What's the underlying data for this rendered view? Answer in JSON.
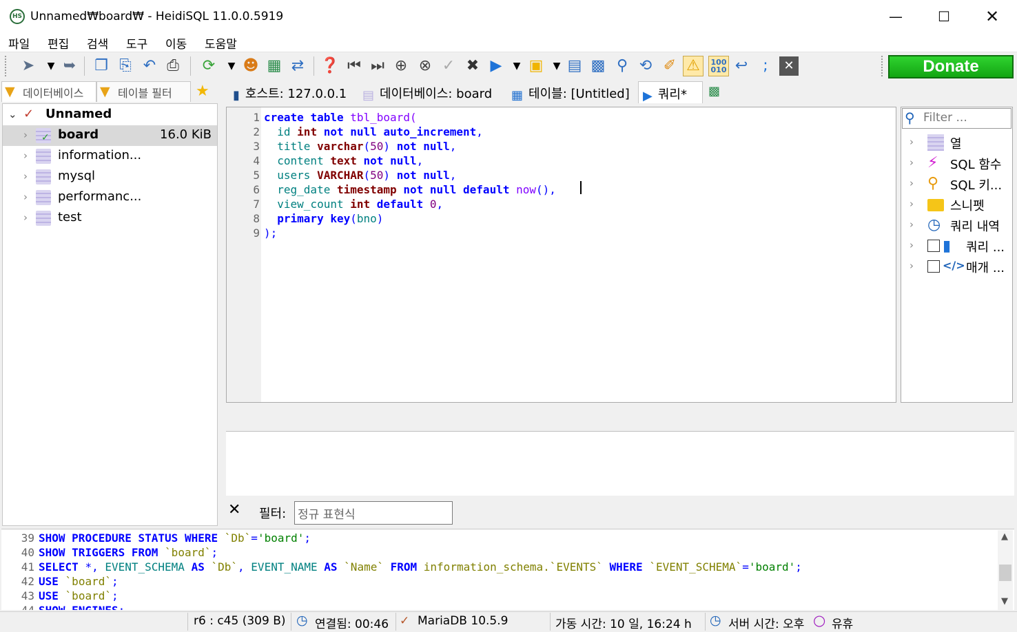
{
  "window": {
    "title": "Unnamed₩board₩ - HeidiSQL 11.0.0.5919",
    "icon_text": "HS",
    "controls": [
      "minimize-icon",
      "maximize-icon",
      "close-icon"
    ]
  },
  "menu": [
    "파일",
    "편집",
    "검색",
    "도구",
    "이동",
    "도움말"
  ],
  "toolbar": {
    "donate_label": "Donate",
    "buttons": [
      "connect-icon",
      "dropdown-arrow-icon",
      "disconnect-icon",
      "copy-icon",
      "paste-icon",
      "undo-icon",
      "print-icon",
      "refresh-icon",
      "user-manager-icon",
      "export-icon",
      "sync-icon",
      "help-icon",
      "first-icon",
      "last-icon",
      "add-icon",
      "cancel-icon",
      "apply-icon",
      "delete-icon",
      "run-icon",
      "open-folder-icon",
      "save-icon",
      "explain-icon",
      "find-icon",
      "replace-icon",
      "clean-icon",
      "warning-icon",
      "binary-icon",
      "wrap-icon",
      "semicolon-icon",
      "close-tab-icon"
    ]
  },
  "left_panel": {
    "tabs": [
      "데이터베이스",
      "테이블 필터"
    ],
    "tree": {
      "root": "Unnamed",
      "items": [
        {
          "label": "board",
          "size": "16.0 KiB",
          "selected": true
        },
        {
          "label": "information...",
          "size": ""
        },
        {
          "label": "mysql",
          "size": ""
        },
        {
          "label": "performanc...",
          "size": ""
        },
        {
          "label": "test",
          "size": ""
        }
      ]
    }
  },
  "main_tabs": [
    {
      "label": "호스트: 127.0.0.1",
      "icon": "server-icon"
    },
    {
      "label": "데이터베이스: board",
      "icon": "database-icon"
    },
    {
      "label": "테이블: [Untitled]",
      "icon": "table-icon"
    },
    {
      "label": "쿼리*",
      "icon": "play-icon",
      "active": true
    }
  ],
  "editor": {
    "line_numbers": [
      "1",
      "2",
      "3",
      "4",
      "5",
      "6",
      "7",
      "8",
      "9"
    ]
  },
  "helpers": {
    "filter_placeholder": "Filter ...",
    "items": [
      {
        "label": "열"
      },
      {
        "label": "SQL 함수"
      },
      {
        "label": "SQL 키..."
      },
      {
        "label": "스니펫"
      },
      {
        "label": "쿼리 내역"
      },
      {
        "label": "쿼리 ..."
      },
      {
        "label": "매개 ..."
      }
    ]
  },
  "filter_bar": {
    "label": "필터:",
    "placeholder": "정규 표현식"
  },
  "log": {
    "line_numbers": [
      "39",
      "40",
      "41",
      "42",
      "43",
      "44"
    ]
  },
  "status": {
    "position": "r6 : c45 (309 B)",
    "connected": "연결됨: 00:46",
    "server": "MariaDB 10.5.9",
    "uptime": "가동 시간: 10 일, 16:24 h",
    "server_time": "서버 시간: 오후",
    "idle": "유휴"
  }
}
